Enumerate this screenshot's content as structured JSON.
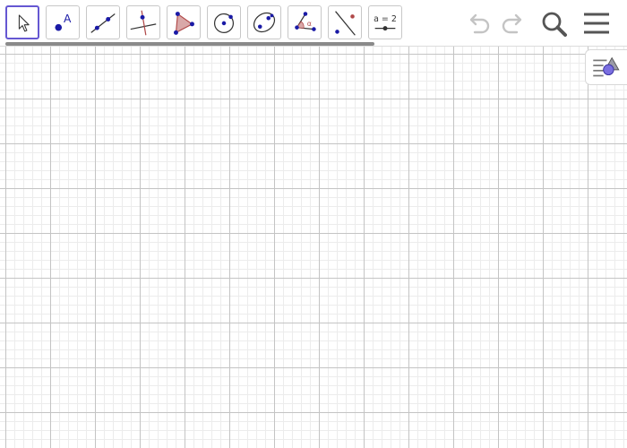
{
  "toolbar": {
    "tools": [
      {
        "id": "move",
        "icon": "move-arrow-icon",
        "selected": true
      },
      {
        "id": "point",
        "icon": "point-icon",
        "label": "A"
      },
      {
        "id": "line",
        "icon": "line-icon"
      },
      {
        "id": "perpendicular-line",
        "icon": "perpendicular-line-icon"
      },
      {
        "id": "polygon",
        "icon": "polygon-icon"
      },
      {
        "id": "circle-center-point",
        "icon": "circle-icon"
      },
      {
        "id": "ellipse",
        "icon": "ellipse-icon"
      },
      {
        "id": "angle",
        "icon": "angle-icon",
        "label": "α"
      },
      {
        "id": "reflect-about-line",
        "icon": "reflect-icon"
      },
      {
        "id": "slider",
        "icon": "slider-icon",
        "label": "a = 2"
      }
    ],
    "actions": {
      "undo": "undo-icon",
      "redo": "redo-icon",
      "search": "search-icon",
      "menu": "hamburger-menu-icon"
    }
  },
  "style_bar_toggle": {
    "icon": "style-bar-icon"
  },
  "colors": {
    "accent": "#6557d2",
    "point": "#1a1aa6",
    "polygon_fill": "#d9a8a8",
    "angle": "#b04848",
    "grid_major": "#c4c4c4",
    "grid_minor": "#ececec"
  }
}
